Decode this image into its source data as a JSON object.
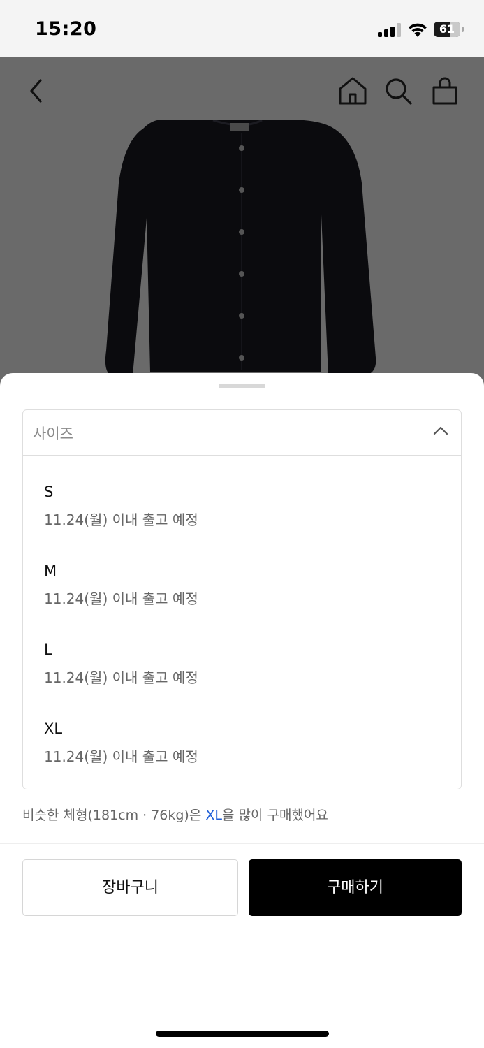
{
  "status_bar": {
    "time": "15:20",
    "battery_level": "61",
    "battery_fraction": 0.61,
    "icons": [
      "signal-icon",
      "wifi-icon",
      "battery-icon"
    ]
  },
  "header": {
    "icons": [
      "back-arrow-icon",
      "home-icon",
      "search-icon",
      "shopping-bag-icon"
    ]
  },
  "size_select": {
    "label": "사이즈",
    "icon": "chevron-up-icon",
    "options": [
      {
        "name": "S",
        "shipping": "11.24(월) 이내 출고 예정"
      },
      {
        "name": "M",
        "shipping": "11.24(월) 이내 출고 예정"
      },
      {
        "name": "L",
        "shipping": "11.24(월) 이내 출고 예정"
      },
      {
        "name": "XL",
        "shipping": "11.24(월) 이내 출고 예정"
      }
    ]
  },
  "recommendation": {
    "prefix": "비슷한 체형(181cm · 76kg)은 ",
    "highlight": "XL",
    "suffix": "을 많이 구매했어요"
  },
  "actions": {
    "cart_label": "장바구니",
    "buy_label": "구매하기"
  },
  "colors": {
    "highlight": "#2060d8",
    "primary_button": "#000000",
    "dim_overlay": "#6a6a6a"
  }
}
